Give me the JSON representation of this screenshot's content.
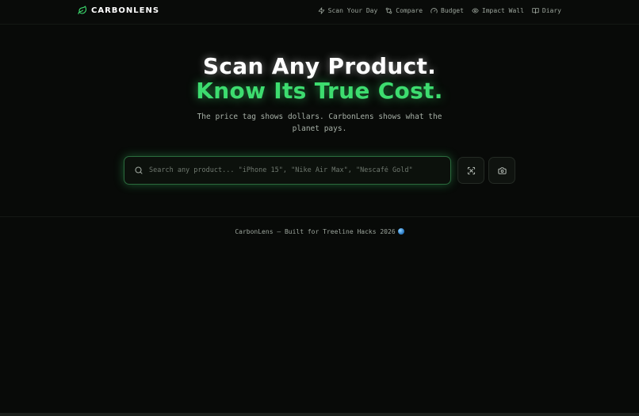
{
  "brand": {
    "name": "CARBONLENS",
    "logo_icon": "leaf-icon",
    "accent_color": "#3ddc6f"
  },
  "nav": {
    "items": [
      {
        "label": "Scan Your Day",
        "icon": "lightning-icon"
      },
      {
        "label": "Compare",
        "icon": "arrows-swap-icon"
      },
      {
        "label": "Budget",
        "icon": "gauge-icon"
      },
      {
        "label": "Impact Wall",
        "icon": "eye-icon"
      },
      {
        "label": "Diary",
        "icon": "book-icon"
      }
    ]
  },
  "hero": {
    "title_line1": "Scan Any Product.",
    "title_line2": "Know Its True Cost.",
    "subtitle": "The price tag shows dollars. CarbonLens shows what the planet pays."
  },
  "search": {
    "placeholder": "Search any product... \"iPhone 15\", \"Nike Air Max\", \"Nescafé Gold\"",
    "value": "",
    "scan_button_icon": "scan-icon",
    "camera_button_icon": "camera-icon"
  },
  "footer": {
    "text": "CarbonLens — Built for Treeline Hacks 2026",
    "emoji_icon": "globe-icon"
  }
}
